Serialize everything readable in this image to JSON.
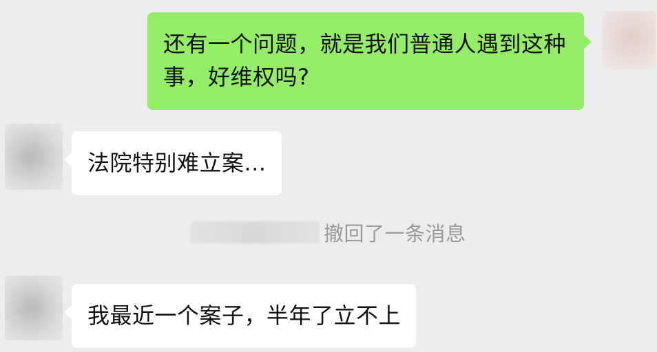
{
  "messages": [
    {
      "sender": "me",
      "text": "还有一个问题，就是我们普通人遇到这种事，好维权吗?"
    },
    {
      "sender": "other",
      "text": "法院特别难立案..."
    },
    {
      "sender": "system",
      "text": "撤回了一条消息"
    },
    {
      "sender": "other",
      "text": "我最近一个案子，半年了立不上"
    }
  ],
  "colors": {
    "background": "#ededed",
    "my_bubble": "#95ec69",
    "other_bubble": "#ffffff",
    "system_text": "#9a9a9a"
  }
}
